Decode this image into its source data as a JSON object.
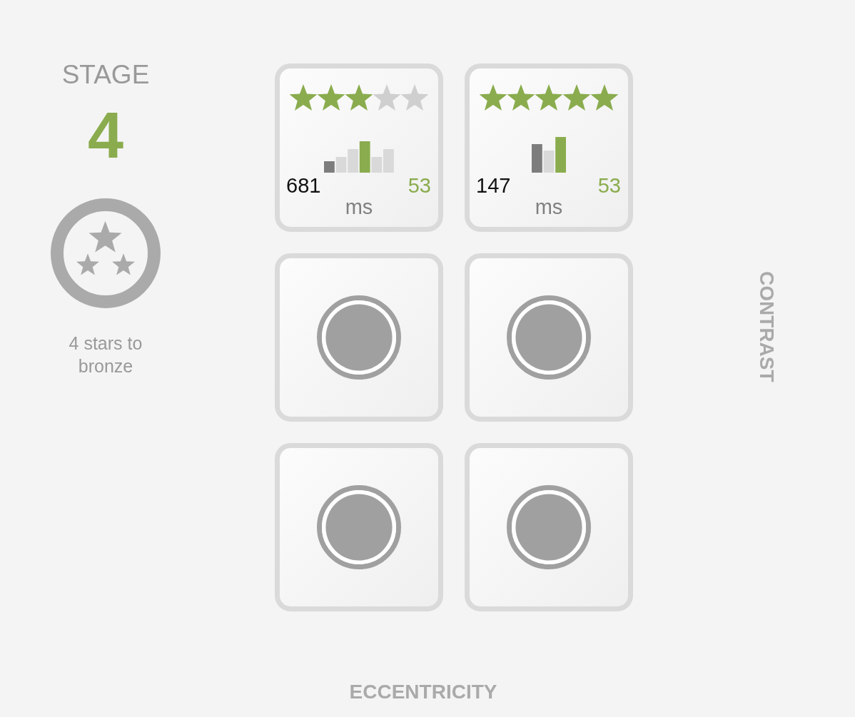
{
  "stage": {
    "label": "STAGE",
    "number": "4"
  },
  "badge": {
    "caption": "4 stars to bronze"
  },
  "tiles": [
    {
      "kind": "result",
      "stars": 3,
      "time": "681",
      "score": "53",
      "unit": "ms"
    },
    {
      "kind": "result",
      "stars": 5,
      "time": "147",
      "score": "53",
      "unit": "ms"
    },
    {
      "kind": "pending"
    },
    {
      "kind": "pending"
    },
    {
      "kind": "pending"
    },
    {
      "kind": "pending"
    }
  ],
  "axes": {
    "x_label": "ECCENTRICITY",
    "y_label": "CONTRAST"
  }
}
